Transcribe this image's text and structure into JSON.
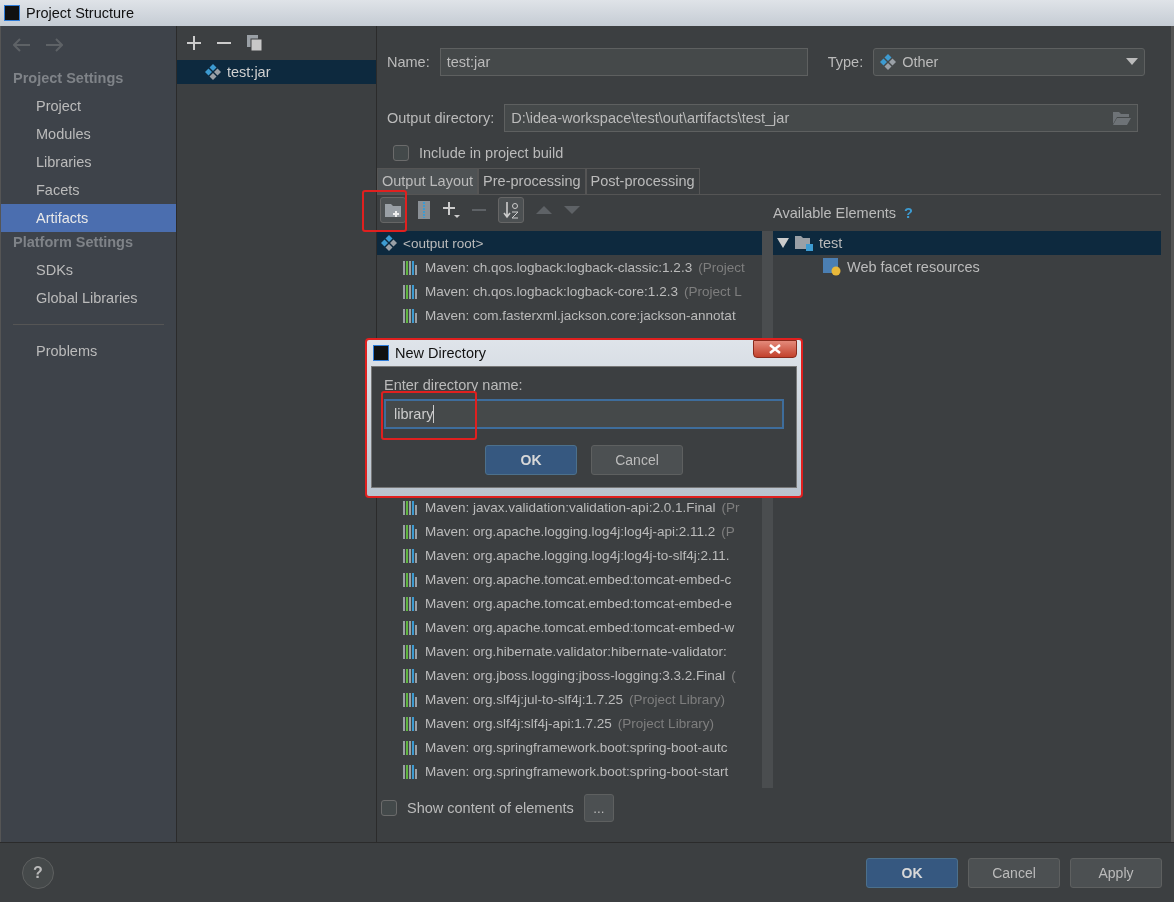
{
  "window": {
    "title": "Project Structure"
  },
  "sidebar": {
    "sections": [
      {
        "heading": "Project Settings",
        "items": [
          {
            "label": "Project",
            "selected": false
          },
          {
            "label": "Modules",
            "selected": false
          },
          {
            "label": "Libraries",
            "selected": false
          },
          {
            "label": "Facets",
            "selected": false
          },
          {
            "label": "Artifacts",
            "selected": true
          }
        ]
      },
      {
        "heading": "Platform Settings",
        "items": [
          {
            "label": "SDKs",
            "selected": false
          },
          {
            "label": "Global Libraries",
            "selected": false
          }
        ]
      }
    ],
    "extra_items": [
      {
        "label": "Problems",
        "selected": false
      }
    ]
  },
  "artifacts": {
    "items": [
      {
        "label": "test:jar",
        "selected": true
      }
    ]
  },
  "form": {
    "name_label": "Name:",
    "name_value": "test:jar",
    "type_label": "Type:",
    "type_value": "Other",
    "output_label": "Output directory:",
    "output_value": "D:\\idea-workspace\\test\\out\\artifacts\\test_jar",
    "include": {
      "label": "Include in project build",
      "checked": false
    }
  },
  "tabs": [
    {
      "label": "Output Layout",
      "selected": true
    },
    {
      "label": "Pre-processing",
      "selected": false
    },
    {
      "label": "Post-processing",
      "selected": false
    }
  ],
  "layout_tree": {
    "root": {
      "label": "<output root>",
      "selected": true
    },
    "rows_before": [
      {
        "name": "Maven: ch.qos.logback:logback-classic:1.2.3",
        "note": "(Project"
      },
      {
        "name": "Maven: ch.qos.logback:logback-core:1.2.3",
        "note": "(Project L"
      },
      {
        "name": "Maven: com.fasterxml.jackson.core:jackson-annotat"
      }
    ],
    "rows_after": [
      {
        "name": "Maven: javax.validation:validation-api:2.0.1.Final",
        "note": "(Pr"
      },
      {
        "name": "Maven: org.apache.logging.log4j:log4j-api:2.11.2",
        "note": "(P"
      },
      {
        "name": "Maven: org.apache.logging.log4j:log4j-to-slf4j:2.11."
      },
      {
        "name": "Maven: org.apache.tomcat.embed:tomcat-embed-c"
      },
      {
        "name": "Maven: org.apache.tomcat.embed:tomcat-embed-e"
      },
      {
        "name": "Maven: org.apache.tomcat.embed:tomcat-embed-w"
      },
      {
        "name": "Maven: org.hibernate.validator:hibernate-validator:"
      },
      {
        "name": "Maven: org.jboss.logging:jboss-logging:3.3.2.Final",
        "note": "("
      },
      {
        "name": "Maven: org.slf4j:jul-to-slf4j:1.7.25",
        "note": "(Project Library)"
      },
      {
        "name": "Maven: org.slf4j:slf4j-api:1.7.25",
        "note": "(Project Library)"
      },
      {
        "name": "Maven: org.springframework.boot:spring-boot-autc"
      },
      {
        "name": "Maven: org.springframework.boot:spring-boot-start"
      }
    ]
  },
  "available": {
    "heading": "Available Elements",
    "help": "?",
    "tree": [
      {
        "label": "test",
        "expanded": true,
        "selected": true,
        "children": [
          {
            "label": "Web facet resources"
          }
        ]
      }
    ]
  },
  "show_content": {
    "label": "Show content of elements",
    "checked": false
  },
  "more_button": "...",
  "dialog": {
    "title": "New Directory",
    "prompt": "Enter directory name:",
    "value": "library",
    "buttons": [
      {
        "label": "OK",
        "kind": "primary"
      },
      {
        "label": "Cancel",
        "kind": "default"
      }
    ]
  },
  "footer": {
    "help": "?",
    "buttons": [
      {
        "label": "OK",
        "kind": "primary"
      },
      {
        "label": "Cancel",
        "kind": "default"
      },
      {
        "label": "Apply",
        "kind": "default"
      }
    ]
  }
}
